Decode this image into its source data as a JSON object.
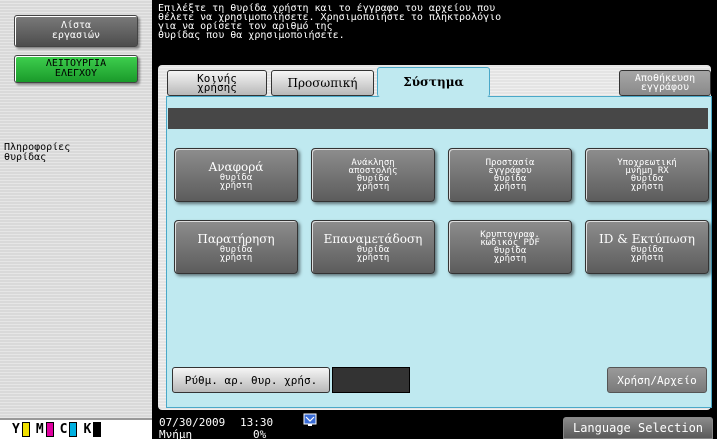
{
  "left": {
    "job_list_line1": "Λίστα",
    "job_list_line2": "εργασιών",
    "utility_line1": "ΛΕΙΤΟΥΡΓΙΑ",
    "utility_line2": "ΕΛΕΓΧΟΥ",
    "port_info_line1": "Πληροφορίες",
    "port_info_line2": "θυρίδας",
    "toner": [
      {
        "letter": "Y",
        "color": "#f0e000"
      },
      {
        "letter": "M",
        "color": "#e000a0"
      },
      {
        "letter": "C",
        "color": "#00b0e0"
      },
      {
        "letter": "K",
        "color": "#000000"
      }
    ]
  },
  "instruction": "Επιλέξτε τη θυρίδα χρήστη και το έγγραφο του αρχείου που\nθέλετε να χρησιμοποιήσετε. Χρησιμοποιήστε το πληκτρολόγιο\nγια να ορίσετε τον αριθμό της\nθυρίδας που θα χρησιμοποιήσετε.",
  "tabs": {
    "public_line1": "Κοινής",
    "public_line2": "χρήσης",
    "personal": "Προσωπική",
    "system": "Σύστημα",
    "store_line1": "Αποθήκευση",
    "store_line2": "εγγράφου"
  },
  "buttons": {
    "b1": {
      "line1": "Αναφορά",
      "line2": "θυρίδα",
      "line3": "χρήστη"
    },
    "b2": {
      "line1": "Ανάκληση",
      "line2": "αποστολής",
      "line3": "θυρίδα",
      "line4": "χρήστη"
    },
    "b3": {
      "line1": "Προστασία",
      "line2": "εγγράφου",
      "line3": "θυρίδα",
      "line4": "χρήστη"
    },
    "b4": {
      "line1": "Υποχρεωτική",
      "line2": "μνήμη RX",
      "line3": "θυρίδα",
      "line4": "χρήστη"
    },
    "b5": {
      "line1": "Παρατήρηση",
      "line2": "θυρίδα",
      "line3": "χρήστη"
    },
    "b6": {
      "line1": "Επαναμετάδοση",
      "line2": "θυρίδα",
      "line3": "χρήστη"
    },
    "b7": {
      "line1": "Κρυπτογραφ.",
      "line2": "κωδικός PDF",
      "line3": "θυρίδα",
      "line4": "χρήστη"
    },
    "b8": {
      "line1": "ID & Εκτύπωση",
      "line2": "θυρίδα",
      "line3": "χρήστη"
    }
  },
  "port_number_button": "Ρύθμ. αρ. θυρ. χρήσ.",
  "user_file_button": "Χρήση/Αρχείο",
  "status": {
    "date": "07/30/2009",
    "time": "13:30",
    "memory_label": "Μνήμη",
    "memory_value": "0%"
  },
  "language_button": "Language Selection"
}
